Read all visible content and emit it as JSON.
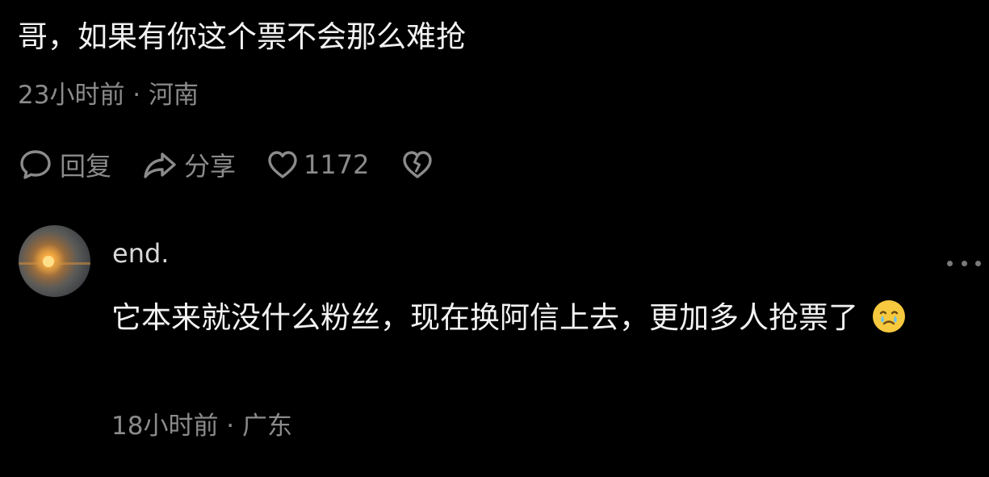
{
  "comment": {
    "text": "哥，如果有你这个票不会那么难抢",
    "meta": "23小时前 · 河南",
    "actions": {
      "reply_icon": "speech-bubble-icon",
      "reply_label": "回复",
      "share_icon": "share-arrow-icon",
      "share_label": "分享",
      "like_icon": "heart-icon",
      "like_count": "1172",
      "dislike_icon": "broken-heart-icon"
    }
  },
  "reply": {
    "avatar": "sunset-avatar",
    "username": "end.",
    "more_icon": "more-dots-icon",
    "text": "它本来就没什么粉丝，现在换阿信上去，更加多人抢票了",
    "emoji": "crying-face-emoji",
    "meta": "18小时前 · 广东"
  },
  "colors": {
    "background": "#000000",
    "primary_text": "#f2f2f2",
    "secondary_text": "#8b8b8b",
    "emoji_yellow": "#f7c93e"
  }
}
